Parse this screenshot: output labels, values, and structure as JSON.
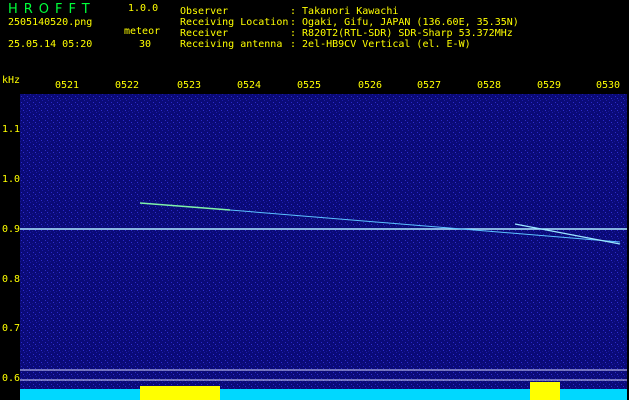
{
  "app": {
    "logo_text": "HROFFT",
    "version": "1.0.0",
    "filename": "2505140520.png",
    "datetime": "25.05.14 05:20",
    "counter_label": "meteor",
    "counter_value": "30"
  },
  "info": [
    {
      "label": "Observer",
      "value": ": Takanori Kawachi"
    },
    {
      "label": "Receiving Location",
      "value": ": Ogaki, Gifu, JAPAN (136.60E, 35.35N)"
    },
    {
      "label": "Receiver",
      "value": ": R820T2(RTL-SDR) SDR-Sharp 53.372MHz"
    },
    {
      "label": "Receiving antenna",
      "value": ": 2el-HB9CV Vertical (el. E-W)"
    }
  ],
  "axis": {
    "y_unit": "kHz",
    "y_ticks": [
      "1.1",
      "1.0",
      "0.9",
      "0.8",
      "0.7",
      "0.6"
    ],
    "x_ticks": [
      "0521",
      "0522",
      "0523",
      "0524",
      "0525",
      "0526",
      "0527",
      "0528",
      "0529",
      "0530"
    ]
  },
  "colors": {
    "text": "#ffff00",
    "logo": "#00ff3a",
    "background_spectrum": "#0a0a78",
    "carrier_line": "#aeeaff"
  }
}
